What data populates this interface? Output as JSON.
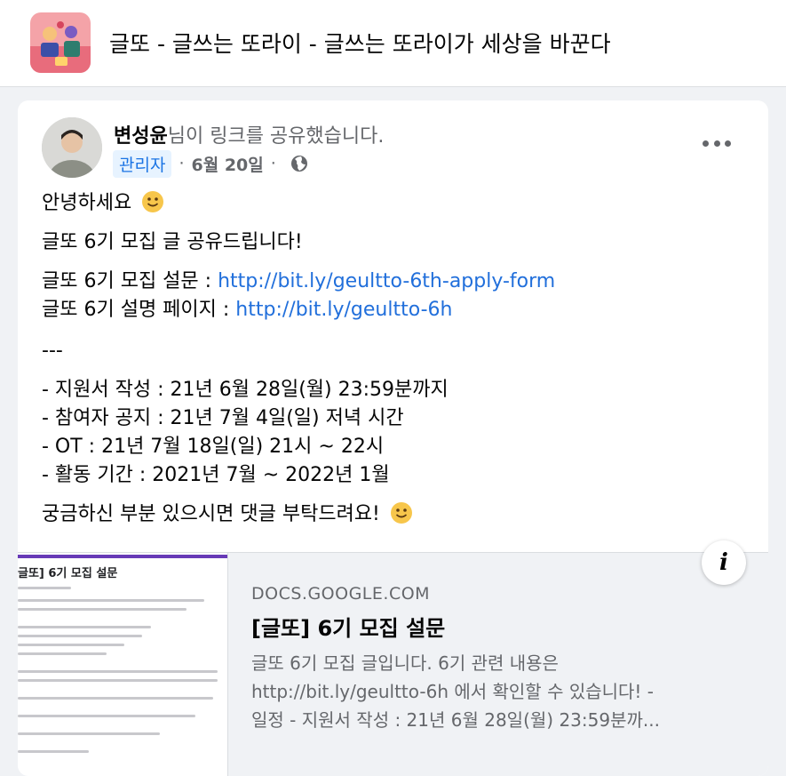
{
  "header": {
    "group_name": "글또 - 글쓰는 또라이 - 글쓰는 또라이가 세상을 바꾼다"
  },
  "post": {
    "author": "변성윤",
    "action": "님이 링크를 공유했습니다.",
    "badge": "관리자",
    "separator": "·",
    "date": "6월 20일",
    "privacy_icon": "globe-icon",
    "lines": [
      {
        "text": "안녕하세요",
        "emoji": "slightly-smiling-face"
      },
      {
        "text": "글또 6기 모집 글 공유드립니다!"
      },
      {
        "label": "글또 6기 모집 설문 : ",
        "link": "http://bit.ly/geultto-6th-apply-form"
      },
      {
        "label": "글또 6기 설명 페이지 : ",
        "link": "http://bit.ly/geultto-6h"
      },
      {
        "text": "---"
      },
      {
        "text": "- 지원서 작성 : 21년 6월 28일(월) 23:59분까지"
      },
      {
        "text": "- 참여자 공지 : 21년 7월 4일(일) 저녁 시간"
      },
      {
        "text": "- OT : 21년 7월 18일(일) 21시 ~ 22시"
      },
      {
        "text": "- 활동 기간 : 2021년 7월 ~ 2022년 1월"
      },
      {
        "text": "궁금하신 부분 있으시면 댓글 부탁드려요!",
        "emoji": "slightly-smiling-face"
      }
    ]
  },
  "link_preview": {
    "domain": "DOCS.GOOGLE.COM",
    "title": "[글또] 6기 모집 설문",
    "description": [
      "글또 6기 모집 글입니다. 6기 관련 내용은",
      "http://bit.ly/geultto-6h 에서 확인할 수 있습니다! -",
      "일정 - 지원서 작성 : 21년 6월 28일(월) 23:59분까..."
    ],
    "thumbnail_title": "글또] 6기 모집 설문",
    "info_label": "i"
  },
  "colors": {
    "link": "#216fdb",
    "badge_bg": "#e7f3ff",
    "badge_text": "#1b74e4",
    "secondary_text": "#65676b",
    "form_accent": "#673ab7"
  }
}
